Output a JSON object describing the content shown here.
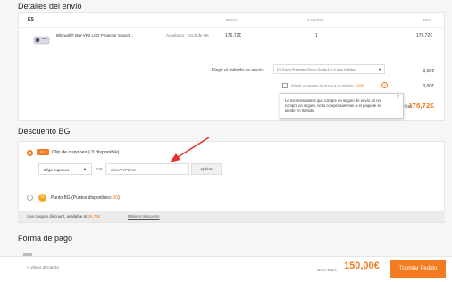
{
  "shipping": {
    "title": "Detalles del envío",
    "store": "ES",
    "headers": {
      "price": "Precio",
      "qty": "Cantidad",
      "total": "Total"
    },
    "product": {
      "name": "Blitzwolf® BW-VP2 LCD Projector Suport...",
      "variant": "Acoplador : Enchufe UK",
      "price": "176,72€",
      "qty": "1",
      "total": "176,72€",
      "icon": "projector-icon"
    },
    "method_label": "Elegir el método de envío:",
    "method_value": "ES Envío Preferido (Envío Gratis & 3-5 días Hábiles)",
    "method_cost": "0,00€",
    "insurance_text": "Añadir un seguro de envío a su pedido:",
    "insurance_amount": "3,53€",
    "insurance_cost": "0,00€",
    "tooltip": "Le recomendamos que compre un seguro de envío. Si no compra un seguro, no lo compensaremos si el paquete se pierde en tránsito.",
    "total_label": "Total:",
    "total_value": "176,72€"
  },
  "discount": {
    "title": "Descuento BG",
    "coupon_label": "Clip de cupones ( 0 disponible)",
    "coupon_select": "Elige cupones",
    "or": "OR",
    "coupon_code": "aroieVVP2AU",
    "apply": "Aplicar",
    "bg_points_label": "Punto BG (Puntos disponibles: ",
    "bg_points_value": "60",
    "bg_points_close": ")",
    "notice_prefix": "Use coupon discount, available at ",
    "notice_amount": "26,72€",
    "remove": "Eliminar descuento",
    "accent": "#f47b20"
  },
  "payment": {
    "title": "Forma de pago"
  },
  "footer": {
    "back": "< Volver al Carrito",
    "total_label": "Gran Total:",
    "total_value": "150,00€",
    "checkout": "Tramitar Pedido"
  }
}
